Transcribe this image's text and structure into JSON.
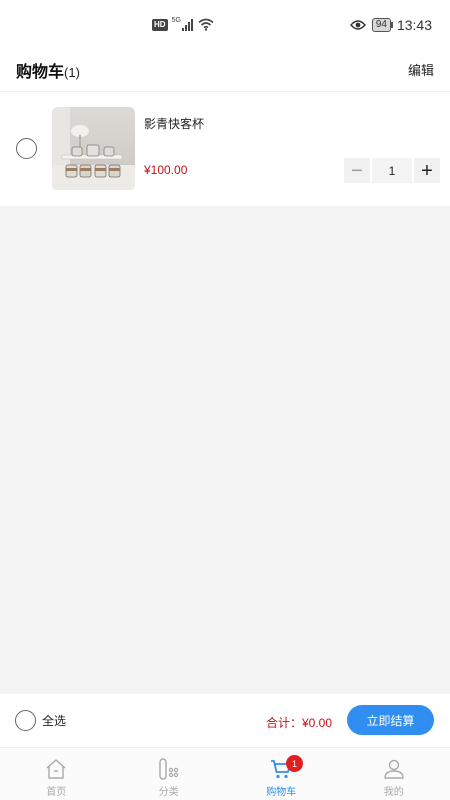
{
  "status_bar": {
    "hd_badge": "HD",
    "network": "5G",
    "battery": "94",
    "time": "13:43"
  },
  "header": {
    "title": "购物车",
    "count": "(1)",
    "edit_label": "编辑"
  },
  "cart_items": [
    {
      "name": "影青快客杯",
      "price": "¥100.00",
      "quantity": "1",
      "minus_symbol": "−",
      "plus_symbol": "+"
    }
  ],
  "checkout": {
    "select_all_label": "全选",
    "total_label": "合计：¥0.00",
    "button_label": "立即结算"
  },
  "tabbar": {
    "tabs": [
      {
        "label": "首页",
        "icon": "home-icon"
      },
      {
        "label": "分类",
        "icon": "category-icon"
      },
      {
        "label": "购物车",
        "icon": "cart-icon",
        "badge": "1"
      },
      {
        "label": "我的",
        "icon": "profile-icon"
      }
    ],
    "active_index": 2
  },
  "colors": {
    "accent": "#2f8ef0",
    "price": "#c0141c",
    "badge": "#e02020"
  }
}
